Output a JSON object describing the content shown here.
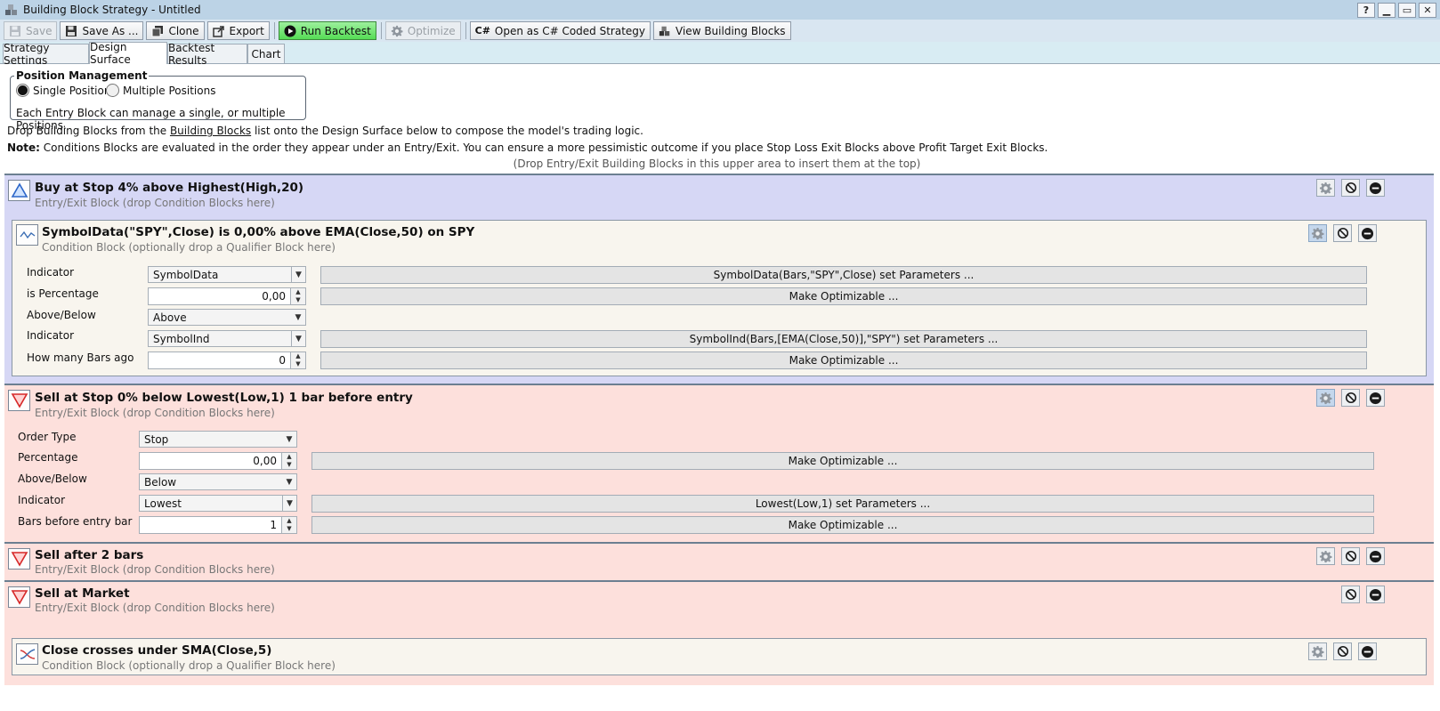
{
  "window": {
    "title": "Building Block Strategy - Untitled",
    "help_label": "?",
    "min_label": "▁",
    "max_label": "▭",
    "close_label": "✕"
  },
  "toolbar": {
    "save": "Save",
    "save_as": "Save As ...",
    "clone": "Clone",
    "export": "Export",
    "run_backtest": "Run Backtest",
    "optimize": "Optimize",
    "open_csharp": "Open as C# Coded Strategy",
    "view_blocks": "View Building Blocks"
  },
  "tabs": [
    "Strategy Settings",
    "Design Surface",
    "Backtest Results",
    "Chart"
  ],
  "position_management": {
    "title": "Position Management",
    "single": "Single Position",
    "multiple": "Multiple Positions",
    "selected": "Single Position",
    "description": "Each Entry Block can manage a single, or multiple Positions."
  },
  "info": {
    "drop_pre": "Drop Building Blocks from the ",
    "drop_link": "Building Blocks",
    "drop_post": " list onto the Design Surface below to compose the model's trading logic.",
    "note_label": "Note:",
    "note_text": " Conditions Blocks are evaluated in the order they appear under an Entry/Exit. You can ensure a more pessimistic outcome if you place Stop Loss Exit Blocks above Profit Target Exit Blocks.",
    "upper_hint": "(Drop Entry/Exit Building Blocks in this upper area to insert them at the top)"
  },
  "blocks": [
    {
      "title": "Buy at Stop 4% above Highest(High,20)",
      "subtitle": "Entry/Exit Block (drop Condition Blocks here)",
      "condition": {
        "title": "SymbolData(\"SPY\",Close) is 0,00% above EMA(Close,50) on SPY",
        "subtitle": "Condition Block (optionally drop a Qualifier Block here)",
        "params": [
          {
            "label": "Indicator",
            "value": "SymbolData",
            "button": "SymbolData(Bars,\"SPY\",Close) set Parameters ..."
          },
          {
            "label": "is Percentage",
            "value": "0,00",
            "button": "Make Optimizable ..."
          },
          {
            "label": "Above/Below",
            "value": "Above",
            "button": ""
          },
          {
            "label": "Indicator",
            "value": "SymbolInd",
            "button": "SymbolInd(Bars,[EMA(Close,50)],\"SPY\") set Parameters ..."
          },
          {
            "label": "How many Bars ago",
            "value": "0",
            "button": "Make Optimizable ..."
          }
        ]
      }
    },
    {
      "title": "Sell at Stop 0% below Lowest(Low,1) 1 bar before entry",
      "subtitle": "Entry/Exit Block (drop Condition Blocks here)",
      "params": [
        {
          "label": "Order Type",
          "value": "Stop",
          "button": ""
        },
        {
          "label": "Percentage",
          "value": "0,00",
          "button": "Make Optimizable ..."
        },
        {
          "label": "Above/Below",
          "value": "Below",
          "button": ""
        },
        {
          "label": "Indicator",
          "value": "Lowest",
          "button": "Lowest(Low,1) set Parameters ..."
        },
        {
          "label": "Bars before entry bar",
          "value": "1",
          "button": "Make Optimizable ..."
        }
      ]
    },
    {
      "title": "Sell after 2 bars",
      "subtitle": "Entry/Exit Block (drop Condition Blocks here)"
    },
    {
      "title": "Sell at Market",
      "subtitle": "Entry/Exit Block (drop Condition Blocks here)",
      "condition": {
        "title": "Close crosses under SMA(Close,5)",
        "subtitle": "Condition Block (optionally drop a Qualifier Block here)"
      }
    }
  ]
}
